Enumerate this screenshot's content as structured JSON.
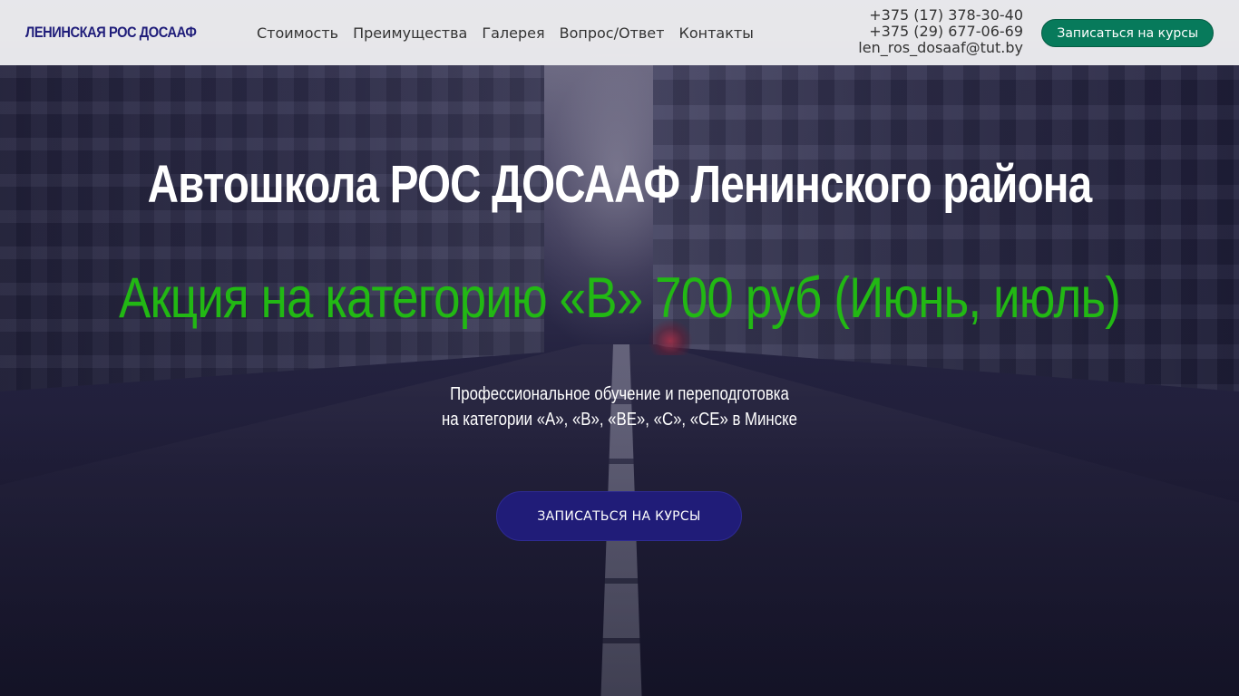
{
  "header": {
    "logo": "ЛЕНИНСКАЯ РОС ДОСААФ",
    "nav": [
      {
        "label": "Стоимость"
      },
      {
        "label": "Преимущества"
      },
      {
        "label": "Галерея"
      },
      {
        "label": "Вопрос/Ответ"
      },
      {
        "label": "Контакты"
      }
    ],
    "contacts": {
      "phone1": "+375 (17) 378-30-40",
      "phone2": "+375 (29) 677-06-69",
      "email": "len_ros_dosaaf@tut.by"
    },
    "cta_label": "Записаться на курсы"
  },
  "hero": {
    "title": "Автошкола РОС ДОСААФ Ленинского района",
    "promo": "Акция на категорию «В» 700 руб (Июнь, июль)",
    "subtitle_line1": "Профессиональное обучение и переподготовка",
    "subtitle_line2": "на категории «А», «В», «ВЕ», «С», «СЕ» в Минске",
    "cta_label": "ЗАПИСАТЬСЯ НА КУРСЫ"
  },
  "colors": {
    "logo": "#1f1d7a",
    "promo": "#22b814",
    "header_cta": "#077a5b",
    "hero_cta": "#201c78"
  }
}
